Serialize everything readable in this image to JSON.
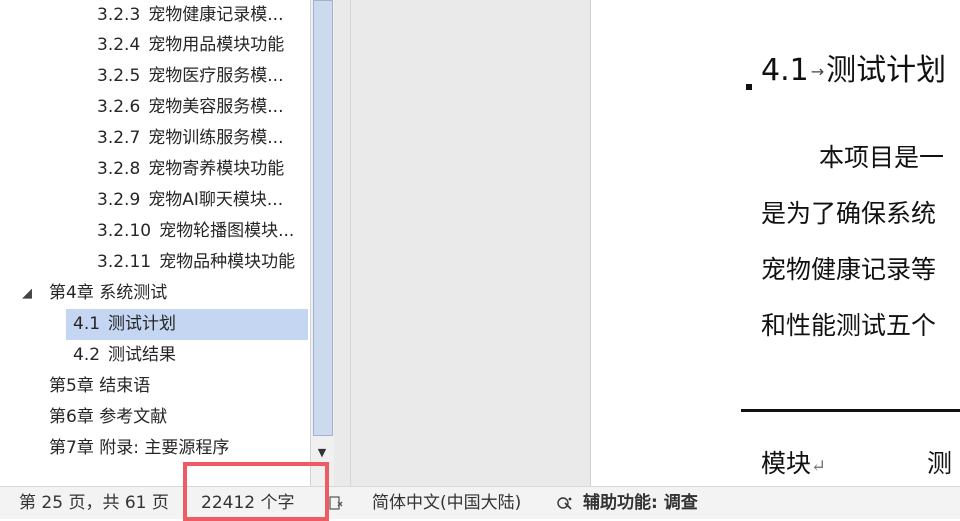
{
  "nav": {
    "items": [
      {
        "num": "3.2.3",
        "label": "宠物健康记录模...",
        "level": 3
      },
      {
        "num": "3.2.4",
        "label": "宠物用品模块功能",
        "level": 3
      },
      {
        "num": "3.2.5",
        "label": "宠物医疗服务模...",
        "level": 3
      },
      {
        "num": "3.2.6",
        "label": "宠物美容服务模...",
        "level": 3
      },
      {
        "num": "3.2.7",
        "label": "宠物训练服务模...",
        "level": 3
      },
      {
        "num": "3.2.8",
        "label": "宠物寄养模块功能",
        "level": 3
      },
      {
        "num": "3.2.9",
        "label": "宠物AI聊天模块...",
        "level": 3
      },
      {
        "num": "3.2.10",
        "label": "宠物轮播图模块...",
        "level": 3
      },
      {
        "num": "3.2.11",
        "label": "宠物品种模块功能",
        "level": 3
      },
      {
        "num": "",
        "label": "第4章 系统测试",
        "level": 1,
        "expanded": true
      },
      {
        "num": "4.1",
        "label": "测试计划",
        "level": 2,
        "selected": true
      },
      {
        "num": "4.2",
        "label": "测试结果",
        "level": 2
      },
      {
        "num": "",
        "label": "第5章 结束语",
        "level": 1
      },
      {
        "num": "",
        "label": "第6章 参考文献",
        "level": 1
      },
      {
        "num": "",
        "label": "第7章 附录: 主要源程序",
        "level": 1
      }
    ],
    "collapse_glyph": "◢",
    "scroll_down_glyph": "▼"
  },
  "document": {
    "heading_num": "4.1",
    "heading_tab_glyph": "→",
    "heading_text": "测试计划",
    "paragraph_lines": [
      "本项目是一",
      "是为了确保系统",
      "宠物健康记录等",
      "和性能测试五个"
    ],
    "table_cells": [
      {
        "text": "模块",
        "return_mark": "↵"
      },
      {
        "text": "测",
        "return_mark": ""
      }
    ]
  },
  "status_bar": {
    "page_info": "第 25 页，共 61 页",
    "word_count": "22412 个字",
    "language": "简体中文(中国大陆)",
    "accessibility_label": "辅助功能: 调查"
  },
  "colors": {
    "selected_item": "#c5d6f2",
    "highlight_box": "#ef5b62",
    "status_bar": "#f3f3f3"
  }
}
